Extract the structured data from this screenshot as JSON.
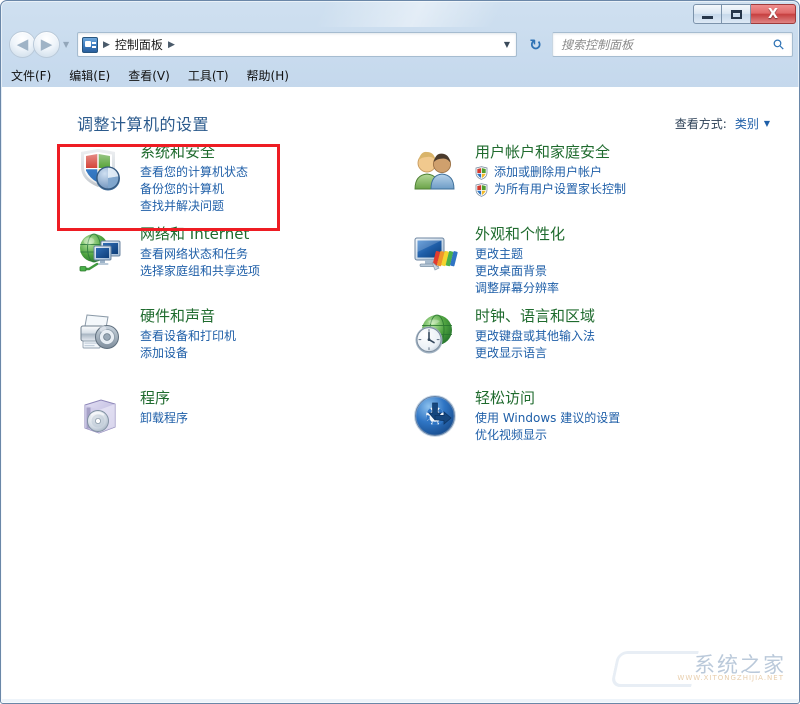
{
  "window": {
    "buttons": {
      "minimize": "Minimize",
      "maximize": "Maximize",
      "close": "X"
    }
  },
  "navbar": {
    "back": "◀",
    "forward": "▶",
    "history_caret": "▼",
    "breadcrumb_icon": "control-panel-icon",
    "breadcrumb": "控制面板",
    "separator": "▶",
    "address_caret": "▼",
    "refresh": "↻",
    "search": {
      "placeholder": "搜索控制面板",
      "value": "",
      "icon": "search-icon"
    }
  },
  "menubar": {
    "items": [
      {
        "label": "文件(F)"
      },
      {
        "label": "编辑(E)"
      },
      {
        "label": "查看(V)"
      },
      {
        "label": "工具(T)"
      },
      {
        "label": "帮助(H)"
      }
    ]
  },
  "content": {
    "page_title": "调整计算机的设置",
    "view_by": {
      "label": "查看方式:",
      "value": "类别",
      "caret": "▼"
    },
    "left_column": [
      {
        "icon": "shield-pie-icon",
        "title": "系统和安全",
        "links": [
          {
            "label": "查看您的计算机状态",
            "shield": false
          },
          {
            "label": "备份您的计算机",
            "shield": false
          },
          {
            "label": "查找并解决问题",
            "shield": false
          }
        ]
      },
      {
        "icon": "globe-monitors-icon",
        "title": "网络和 Internet",
        "links": [
          {
            "label": "查看网络状态和任务",
            "shield": false
          },
          {
            "label": "选择家庭组和共享选项",
            "shield": false
          }
        ]
      },
      {
        "icon": "printer-icon",
        "title": "硬件和声音",
        "links": [
          {
            "label": "查看设备和打印机",
            "shield": false
          },
          {
            "label": "添加设备",
            "shield": false
          }
        ]
      },
      {
        "icon": "programs-cd-icon",
        "title": "程序",
        "links": [
          {
            "label": "卸载程序",
            "shield": false
          }
        ]
      }
    ],
    "right_column": [
      {
        "icon": "users-icon",
        "title": "用户帐户和家庭安全",
        "links": [
          {
            "label": "添加或删除用户帐户",
            "shield": true
          },
          {
            "label": "为所有用户设置家长控制",
            "shield": true
          }
        ]
      },
      {
        "icon": "display-palette-icon",
        "title": "外观和个性化",
        "links": [
          {
            "label": "更改主题",
            "shield": false
          },
          {
            "label": "更改桌面背景",
            "shield": false
          },
          {
            "label": "调整屏幕分辨率",
            "shield": false
          }
        ]
      },
      {
        "icon": "clock-globe-icon",
        "title": "时钟、语言和区域",
        "links": [
          {
            "label": "更改键盘或其他输入法",
            "shield": false
          },
          {
            "label": "更改显示语言",
            "shield": false
          }
        ]
      },
      {
        "icon": "ease-of-access-icon",
        "title": "轻松访问",
        "links": [
          {
            "label": "使用 Windows 建议的设置",
            "shield": false
          },
          {
            "label": "优化视频显示",
            "shield": false
          }
        ]
      }
    ]
  },
  "annotation": {
    "highlight_color": "#ee1c23",
    "highlight_target": "系统和安全"
  },
  "watermark": {
    "text": "系统之家",
    "subtext": "WWW.XITONGZHIJIA.NET"
  },
  "colors": {
    "category_title": "#1f6b2e",
    "link": "#1f5fa8",
    "page_title": "#2b5a8c",
    "highlight": "#ee1c23"
  }
}
